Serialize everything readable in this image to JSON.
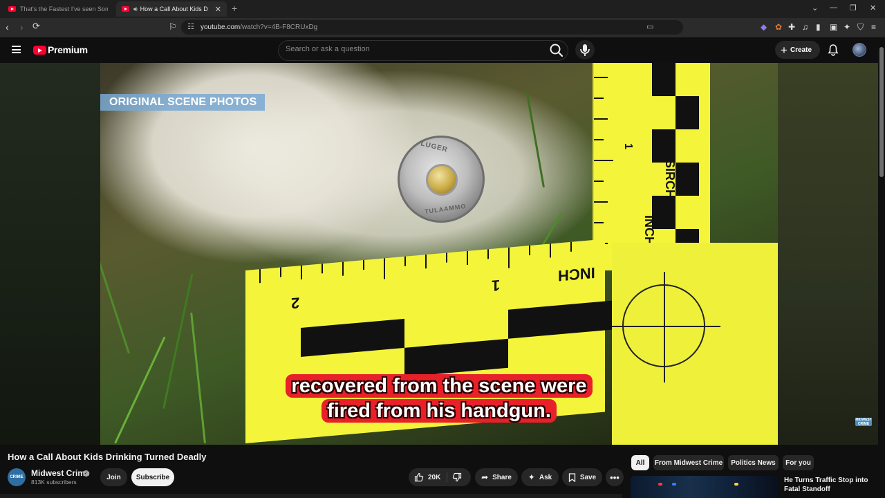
{
  "browser": {
    "tabs": [
      {
        "title": "That's the Fastest I've seen Someone",
        "active": false
      },
      {
        "title": "How a Call About Kids Drinking",
        "active": true
      }
    ],
    "new_tab_label": "+",
    "url_host": "youtube.com",
    "url_path": "/watch?v=4B-F8CRUxDg"
  },
  "youtube": {
    "logo_text": "Premium",
    "search_placeholder": "Search or ask a question",
    "create_label": "Create"
  },
  "video": {
    "overlay_label": "ORIGINAL SCENE PHOTOS",
    "caption_lines": [
      "recovered from the scene were",
      "fired from his handgun."
    ],
    "headstamp_top": "LUGER",
    "headstamp_bottom": "TULAAMMO",
    "ruler_v_numeral": "1",
    "ruler_v_brand": "SIRCHIE",
    "ruler_v_unit": "INCH",
    "ruler_h_numeral_1": "1",
    "ruler_h_numeral_2": "2",
    "ruler_h_unit": "INCH",
    "watermark_text": "MIDWEST CRIME",
    "title": "How a Call About Kids Drinking Turned Deadly"
  },
  "channel": {
    "name": "Midwest Crime",
    "subscribers": "813K subscribers",
    "avatar_text": "CRIME",
    "join_label": "Join",
    "subscribe_label": "Subscribe"
  },
  "actions": {
    "likes": "20K",
    "share_label": "Share",
    "ask_label": "Ask",
    "save_label": "Save"
  },
  "chips": [
    "All",
    "From Midwest Crime",
    "Politics News",
    "For you"
  ],
  "recommendation": {
    "title": "He Turns Traffic Stop into Fatal Standoff"
  },
  "colors": {
    "brand_red": "#ff0033",
    "caption_bg": "#e8202a",
    "scene_label_bg": "#78a8d2",
    "ruler_yellow": "#f4f53a"
  }
}
